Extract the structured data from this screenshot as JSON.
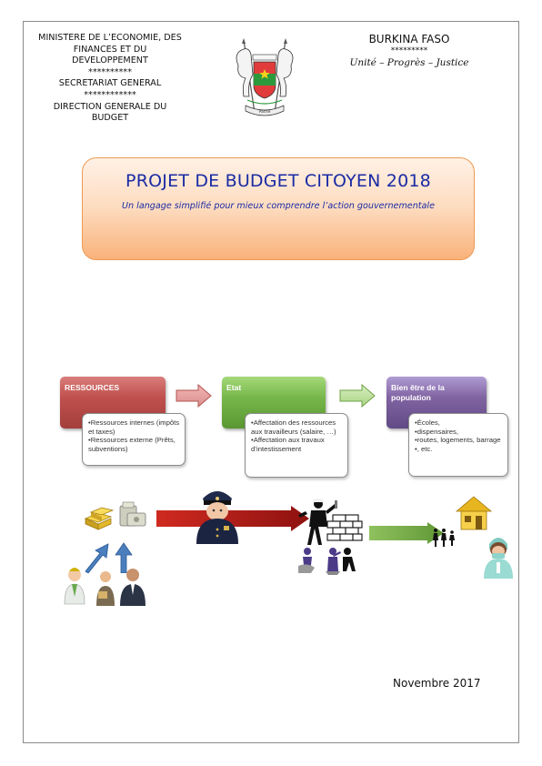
{
  "header_left": {
    "ministry": [
      "MINISTERE DE L’ECONOMIE, DES",
      "FINANCES ET DU",
      "DEVELOPPEMENT"
    ],
    "sep1": "**********",
    "secretariat": "SECRETARIAT GENERAL",
    "sep2": "************",
    "direction": [
      "DIRECTION GENERALE DU",
      "BUDGET"
    ]
  },
  "header_right": {
    "country": "BURKINA FASO",
    "sep": "*********",
    "motto": "Unité – Progrès – Justice"
  },
  "emblem": {
    "banner_text": "Patrie"
  },
  "title_box": {
    "title": "PROJET DE BUDGET CITOYEN 2018",
    "subtitle": "Un langage simplifié pour mieux comprendre l’action gouvernementale"
  },
  "flow": {
    "stages": [
      {
        "label": "RESSOURCES",
        "color": "#c0504d",
        "items": [
          "•Ressources internes (impôts et taxes)",
          "•Ressources externe (Prêts, subventions)"
        ]
      },
      {
        "label": "Etat",
        "color": "#77b74a",
        "items": [
          "•Affectation des ressources aux travailleurs (salaire, …)",
          "•Affectation aux travaux d’intestissement"
        ]
      },
      {
        "label_lines": [
          "Bien être de la",
          "population"
        ],
        "color": "#8064a2",
        "items": [
          "•Écoles,",
          "•dispensaires,",
          "•routes, logements, barrage",
          "•, etc."
        ]
      }
    ]
  },
  "date": "Novembre 2017"
}
